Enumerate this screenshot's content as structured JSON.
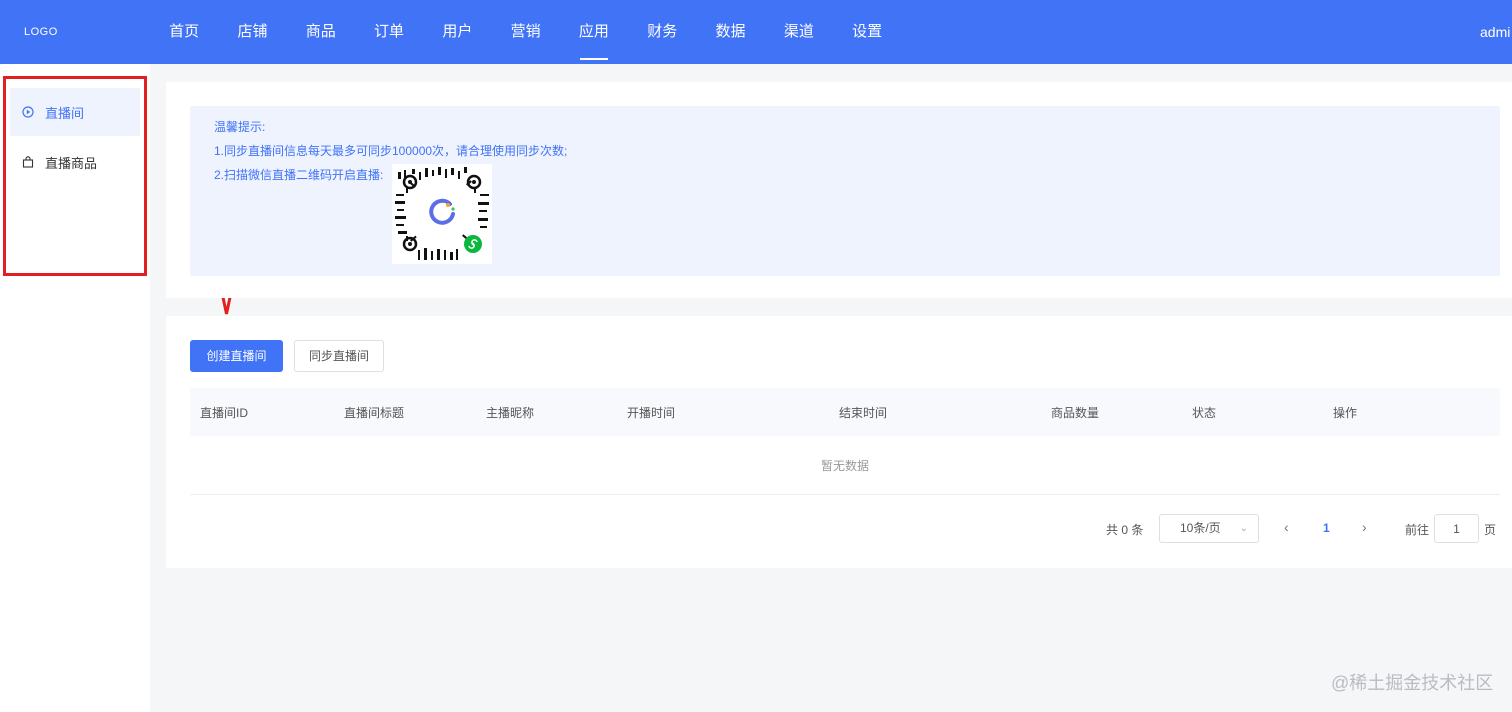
{
  "header": {
    "logo": "LOGO",
    "nav": [
      "首页",
      "店铺",
      "商品",
      "订单",
      "用户",
      "营销",
      "应用",
      "财务",
      "数据",
      "渠道",
      "设置"
    ],
    "active_nav": "应用",
    "user": "admi"
  },
  "sidebar": {
    "items": [
      {
        "label": "直播间",
        "icon": "play-circle-icon",
        "active": true
      },
      {
        "label": "直播商品",
        "icon": "shopping-bag-icon",
        "active": false
      }
    ]
  },
  "tip": {
    "title": "温馨提示:",
    "line1": "1.同步直播间信息每天最多可同步100000次，请合理使用同步次数;",
    "line2": "2.扫描微信直播二维码开启直播:",
    "qr": "wechat-miniprogram-qr-code"
  },
  "toolbar": {
    "create_label": "创建直播间",
    "sync_label": "同步直播间"
  },
  "table": {
    "columns": [
      "直播间ID",
      "直播间标题",
      "主播昵称",
      "开播时间",
      "结束时间",
      "商品数量",
      "状态",
      "操作"
    ],
    "rows": [],
    "empty_text": "暂无数据"
  },
  "pagination": {
    "total": "共 0 条",
    "page_size": "10条/页",
    "current_page": "1",
    "goto_label": "前往",
    "goto_value": "1",
    "page_unit": "页"
  },
  "watermark": "@稀土掘金技术社区",
  "colors": {
    "primary": "#4173f7",
    "annotation": "#e32020",
    "tip_background": "#eef3fe"
  }
}
